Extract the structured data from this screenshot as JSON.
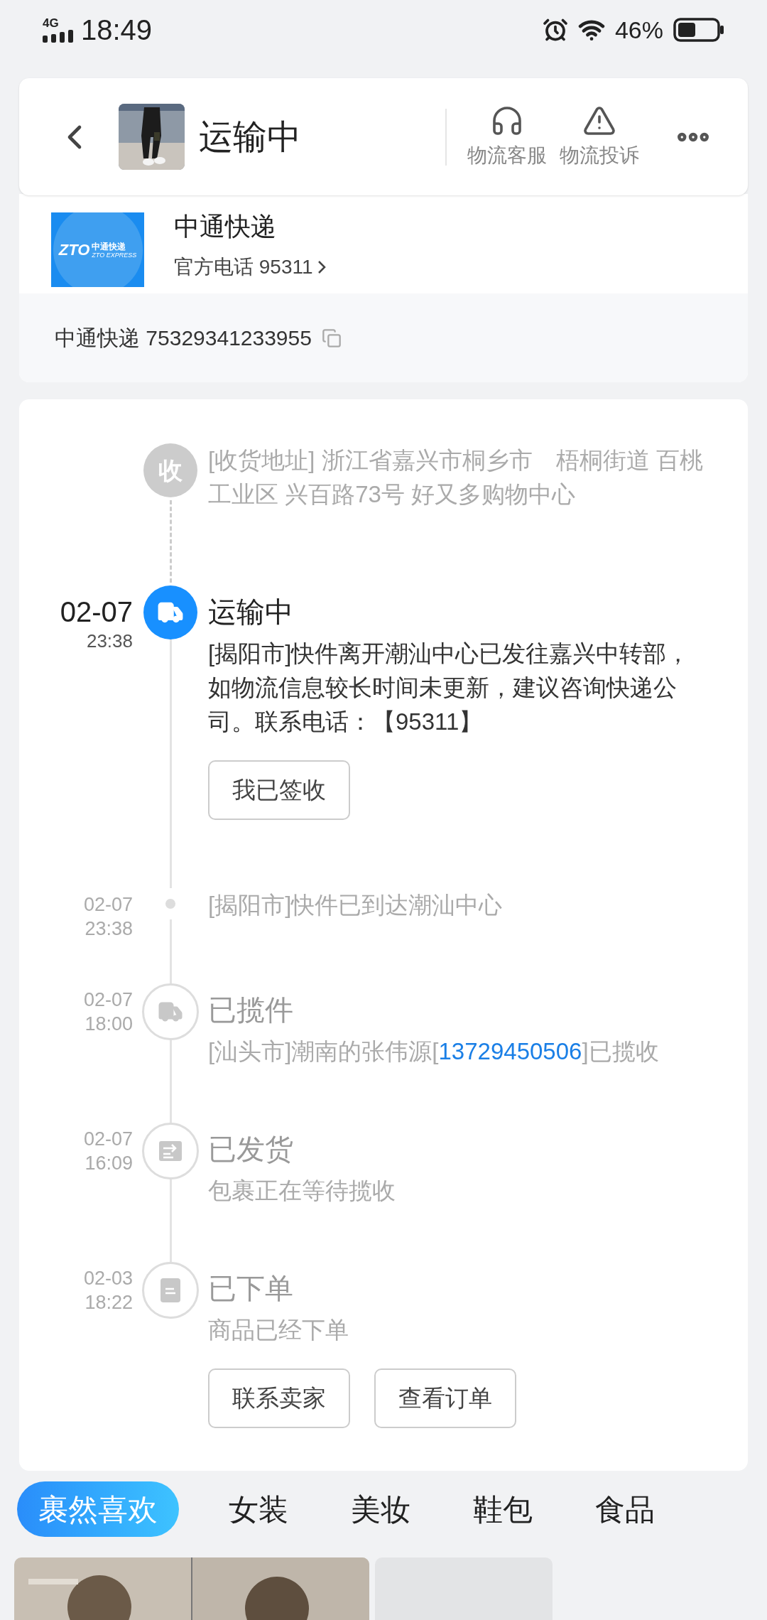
{
  "status_bar": {
    "network": "4G",
    "time": "18:49",
    "battery": "46%"
  },
  "header": {
    "title": "运输中",
    "actions": [
      {
        "label": "物流客服",
        "kind": "service"
      },
      {
        "label": "物流投诉",
        "kind": "complaint"
      }
    ]
  },
  "courier": {
    "logo": {
      "mark": "ZTO",
      "name": "中通快递",
      "sub": "ZTO EXPRESS"
    },
    "name": "中通快递",
    "phone": "官方电话 95311",
    "tracking": "中通快递 75329341233955"
  },
  "timeline": [
    {
      "kind": "address",
      "active": false,
      "badge": "收",
      "body": "[收货地址] 浙江省嘉兴市桐乡市　梧桐街道 百桃工业区 兴百路73号 好又多购物中心"
    },
    {
      "kind": "transit",
      "active": true,
      "date": "02-07",
      "time": "23:38",
      "title": "运输中",
      "body": "[揭阳市]快件离开潮汕中心已发往嘉兴中转部，如物流信息较长时间未更新，建议咨询快递公司。联系电话：【95311】",
      "buttons": [
        "我已签收"
      ]
    },
    {
      "kind": "update",
      "active": false,
      "date": "02-07",
      "time": "23:38",
      "body": "[揭阳市]快件已到达潮汕中心"
    },
    {
      "kind": "pickup",
      "active": false,
      "date": "02-07",
      "time": "18:00",
      "title": "已揽件",
      "body": "[汕头市]潮南的张伟源[",
      "link": "13729450506",
      "body_after": "]已揽收"
    },
    {
      "kind": "shipped",
      "active": false,
      "date": "02-07",
      "time": "16:09",
      "title": "已发货",
      "body": "包裹正在等待揽收"
    },
    {
      "kind": "ordered",
      "active": false,
      "date": "02-03",
      "time": "18:22",
      "title": "已下单",
      "body": "商品已经下单",
      "buttons": [
        "联系卖家",
        "查看订单"
      ]
    }
  ],
  "tabs": [
    {
      "label": "裹然喜欢",
      "selected": true
    },
    {
      "label": "女装",
      "selected": false
    },
    {
      "label": "美妆",
      "selected": false
    },
    {
      "label": "鞋包",
      "selected": false
    },
    {
      "label": "食品",
      "selected": false
    }
  ]
}
